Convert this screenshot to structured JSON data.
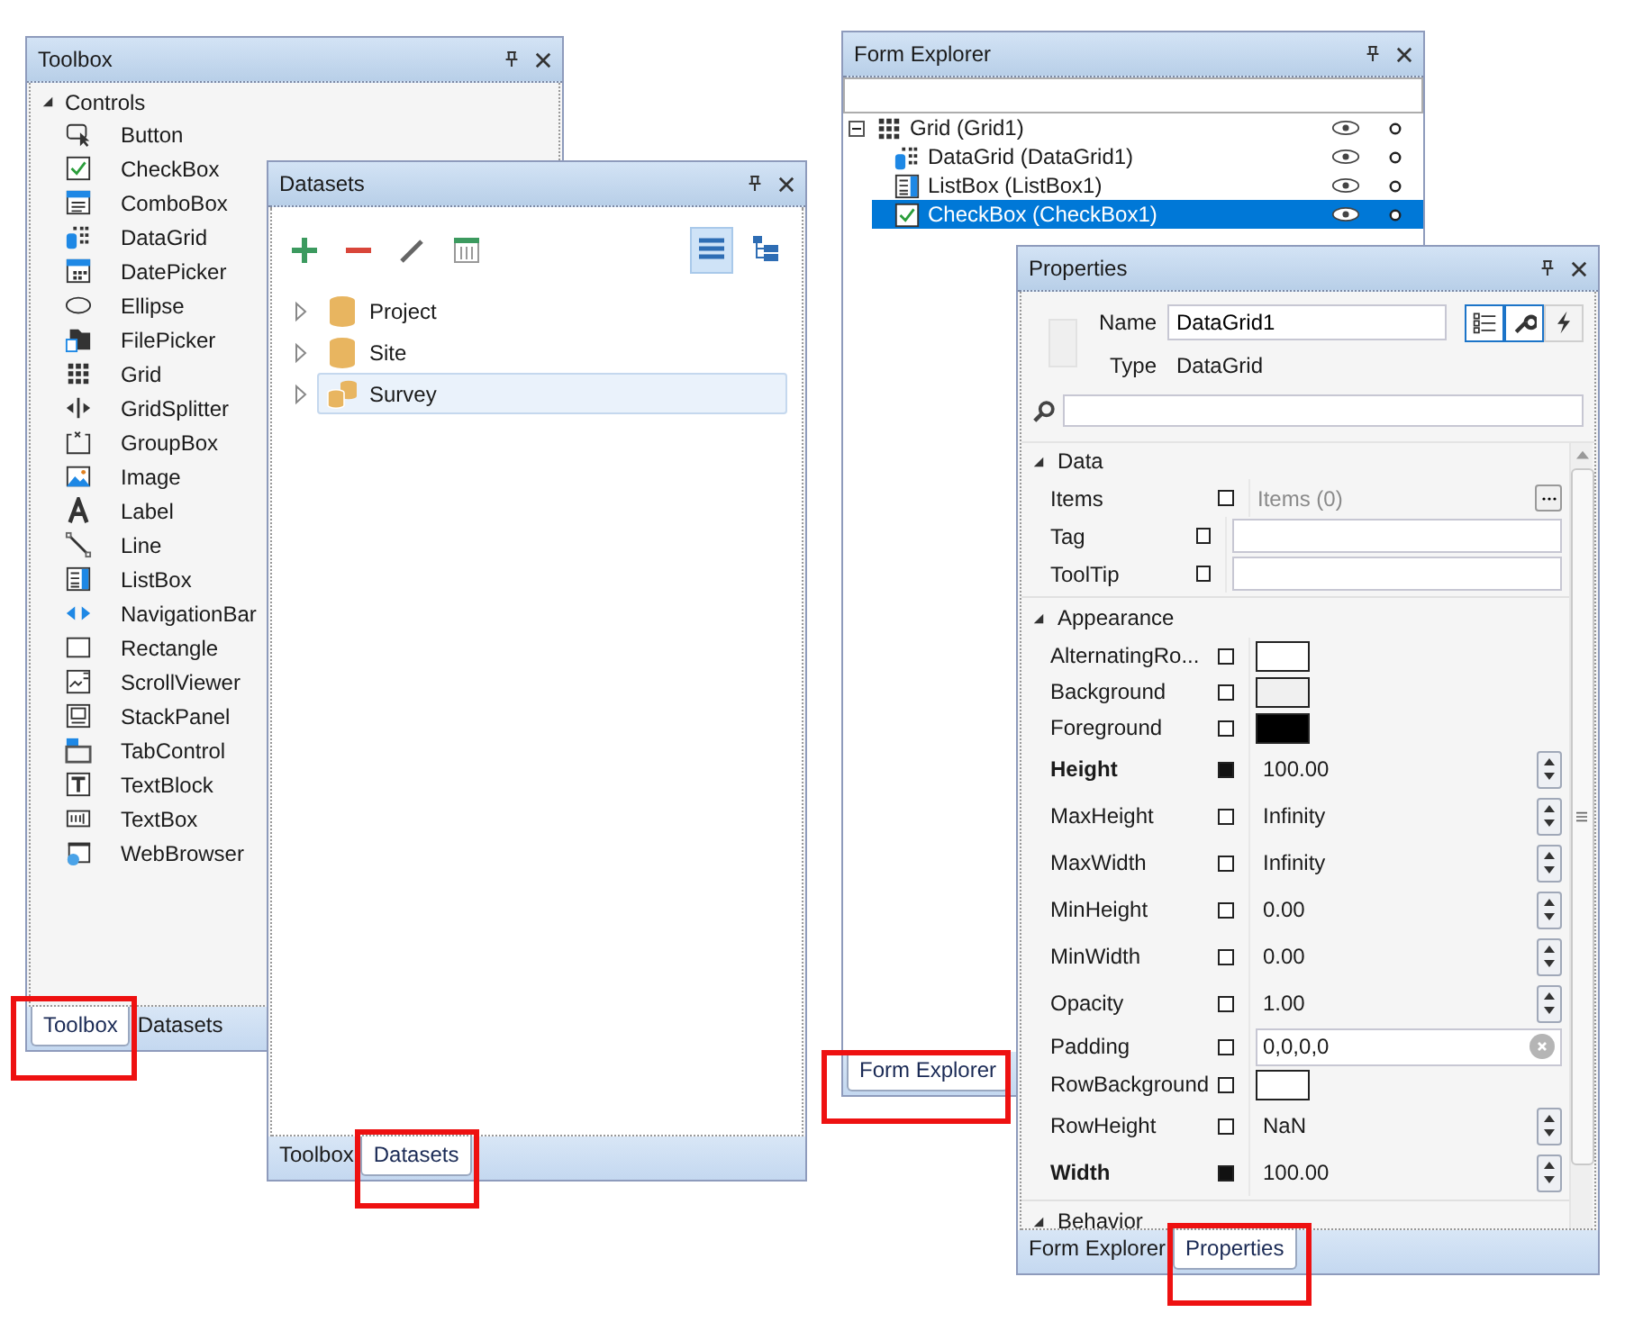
{
  "toolbox": {
    "title": "Toolbox",
    "group": {
      "label": "Controls",
      "expanded": true
    },
    "items": [
      {
        "label": "Button"
      },
      {
        "label": "CheckBox"
      },
      {
        "label": "ComboBox"
      },
      {
        "label": "DataGrid"
      },
      {
        "label": "DatePicker"
      },
      {
        "label": "Ellipse"
      },
      {
        "label": "FilePicker"
      },
      {
        "label": "Grid"
      },
      {
        "label": "GridSplitter"
      },
      {
        "label": "GroupBox"
      },
      {
        "label": "Image"
      },
      {
        "label": "Label"
      },
      {
        "label": "Line"
      },
      {
        "label": "ListBox"
      },
      {
        "label": "NavigationBar"
      },
      {
        "label": "Rectangle"
      },
      {
        "label": "ScrollViewer"
      },
      {
        "label": "StackPanel"
      },
      {
        "label": "TabControl"
      },
      {
        "label": "TextBlock"
      },
      {
        "label": "TextBox"
      },
      {
        "label": "WebBrowser"
      }
    ],
    "tabs": [
      {
        "label": "Toolbox",
        "selected": true
      },
      {
        "label": "Datasets",
        "selected": false
      }
    ]
  },
  "datasets": {
    "title": "Datasets",
    "view_buttons": [
      {
        "selected": true
      },
      {
        "selected": false
      }
    ],
    "items": [
      {
        "label": "Project",
        "kind": "table",
        "expanded": false,
        "selected": false
      },
      {
        "label": "Site",
        "kind": "table",
        "expanded": false,
        "selected": false
      },
      {
        "label": "Survey",
        "kind": "group",
        "expanded": false,
        "selected": true
      }
    ],
    "tabs": [
      {
        "label": "Toolbox",
        "selected": false
      },
      {
        "label": "Datasets",
        "selected": true
      }
    ]
  },
  "form_explorer": {
    "title": "Form Explorer",
    "tree": [
      {
        "label": "Grid (Grid1)",
        "expanded": true,
        "selected": false,
        "children": [
          {
            "label": "DataGrid (DataGrid1)",
            "selected": false
          },
          {
            "label": "ListBox (ListBox1)",
            "selected": false
          },
          {
            "label": "CheckBox (CheckBox1)",
            "selected": true
          }
        ]
      }
    ],
    "tabs": [
      {
        "label": "Form Explorer",
        "selected": true
      }
    ]
  },
  "properties": {
    "title": "Properties",
    "name_label": "Name",
    "name_value": "DataGrid1",
    "type_label": "Type",
    "type_value": "DataGrid",
    "mode_buttons": [
      {
        "selected": true
      },
      {
        "selected": true
      },
      {
        "selected": false
      }
    ],
    "categories": [
      {
        "label": "Data",
        "expanded": true,
        "rows": [
          {
            "name": "Items",
            "kind": "collection",
            "set": false,
            "value": "Items (0)"
          },
          {
            "name": "Tag",
            "kind": "text",
            "set": false
          },
          {
            "name": "ToolTip",
            "kind": "text",
            "set": false
          }
        ]
      },
      {
        "label": "Appearance",
        "expanded": true,
        "rows": [
          {
            "name": "AlternatingRo...",
            "kind": "color",
            "set": false,
            "color": "#ffffff"
          },
          {
            "name": "Background",
            "kind": "color",
            "set": false,
            "color": "#f0f0f0"
          },
          {
            "name": "Foreground",
            "kind": "color",
            "set": false,
            "color": "#000000"
          },
          {
            "name": "Height",
            "kind": "number",
            "set": true,
            "value": "100.00"
          },
          {
            "name": "MaxHeight",
            "kind": "number",
            "set": false,
            "value": "Infinity"
          },
          {
            "name": "MaxWidth",
            "kind": "number",
            "set": false,
            "value": "Infinity"
          },
          {
            "name": "MinHeight",
            "kind": "number",
            "set": false,
            "value": "0.00"
          },
          {
            "name": "MinWidth",
            "kind": "number",
            "set": false,
            "value": "0.00"
          },
          {
            "name": "Opacity",
            "kind": "number",
            "set": false,
            "value": "1.00"
          },
          {
            "name": "Padding",
            "kind": "thickness",
            "set": false,
            "value": "0,0,0,0"
          },
          {
            "name": "RowBackground",
            "kind": "color",
            "set": false,
            "color": "#ffffff"
          },
          {
            "name": "RowHeight",
            "kind": "number",
            "set": false,
            "value": "NaN"
          },
          {
            "name": "Width",
            "kind": "number",
            "set": true,
            "value": "100.00"
          }
        ]
      },
      {
        "label": "Behavior",
        "expanded": true
      }
    ],
    "tabs": [
      {
        "label": "Form Explorer",
        "selected": false
      },
      {
        "label": "Properties",
        "selected": true
      }
    ]
  }
}
